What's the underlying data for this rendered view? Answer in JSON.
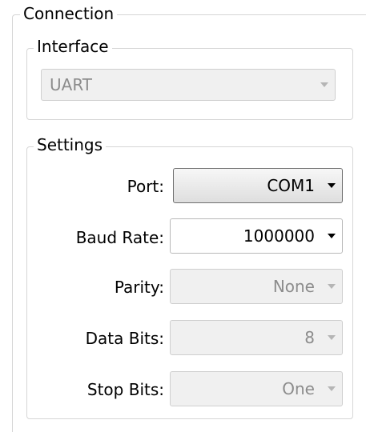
{
  "connection": {
    "title": "Connection",
    "interface": {
      "title": "Interface",
      "value": "UART",
      "dropdown_icon": "chevron-down-icon"
    },
    "settings": {
      "title": "Settings",
      "port": {
        "label": "Port:",
        "value": "COM1"
      },
      "baud_rate": {
        "label": "Baud Rate:",
        "value": "1000000"
      },
      "parity": {
        "label": "Parity:",
        "value": "None"
      },
      "data_bits": {
        "label": "Data Bits:",
        "value": "8"
      },
      "stop_bits": {
        "label": "Stop Bits:",
        "value": "One"
      }
    }
  },
  "colors": {
    "group_border": "#d6d6d6",
    "disabled_text": "#8c8c8c",
    "disabled_bg": "#f0f0f0"
  }
}
